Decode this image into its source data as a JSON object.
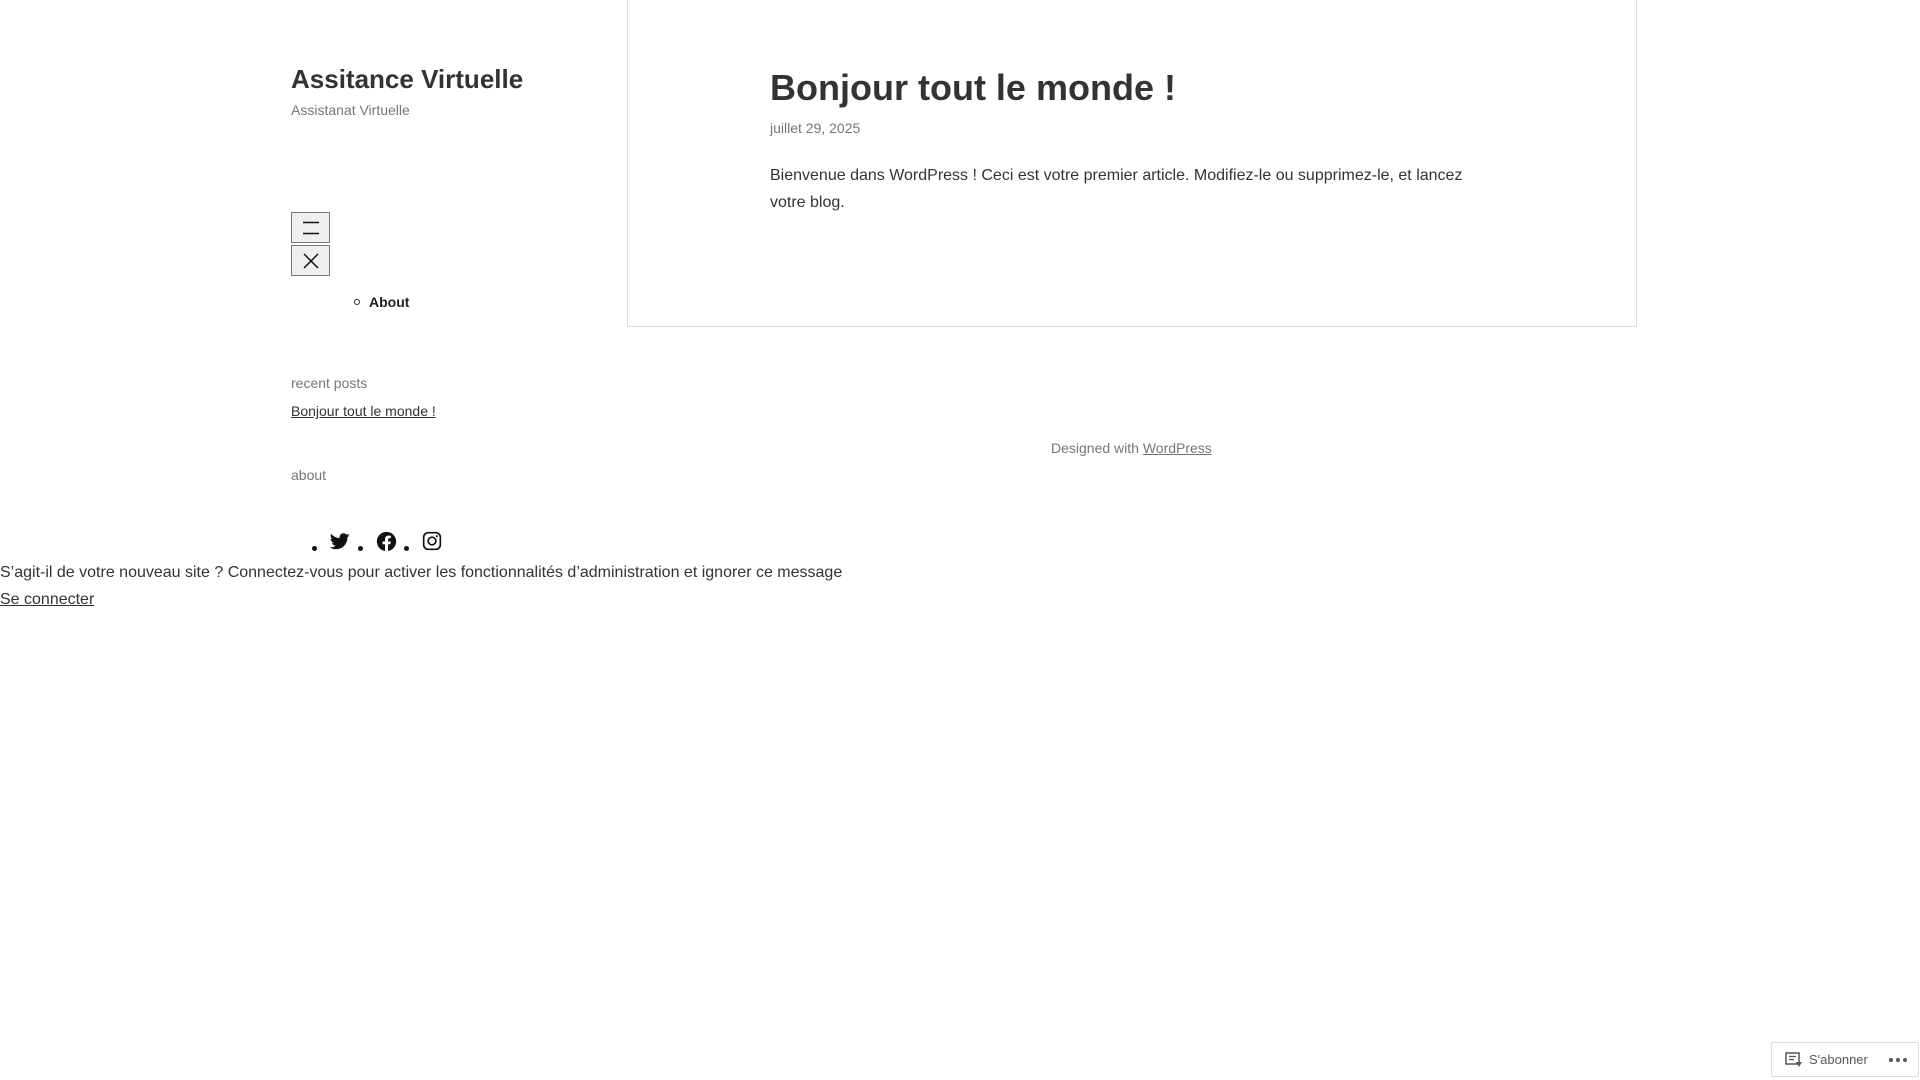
{
  "site": {
    "title": "Assitance Virtuelle",
    "tagline": "Assistanat Virtuelle"
  },
  "navigation": {
    "open_icon": "hamburger-menu-icon",
    "close_icon": "close-icon",
    "items": [
      {
        "label": "About"
      }
    ]
  },
  "widgets": {
    "recent_posts_heading": "recent posts",
    "recent_posts": [
      {
        "label": "Bonjour tout le monde !"
      }
    ],
    "about_heading": "about"
  },
  "social": {
    "icons": [
      "twitter-icon",
      "facebook-icon",
      "instagram-icon"
    ]
  },
  "admin_notice": {
    "message": "S’agit-il de votre nouveau site ? Connectez-vous pour activer les fonctionnalités d’administration et ignorer ce message",
    "login_label": "Se connecter"
  },
  "post": {
    "title": "Bonjour tout le monde !",
    "date": "juillet 29, 2025",
    "body": "Bienvenue dans WordPress ! Ceci est votre premier article. Modifiez-le ou supprimez-le, et lancez votre blog."
  },
  "footer": {
    "credit_prefix": "Designed with",
    "credit_link": "WordPress"
  },
  "subscribe_bar": {
    "subscribe_label": "S'abonner",
    "subscribe_icon": "reader-icon",
    "more_icon": "ellipsis-icon"
  },
  "colors": {
    "text": "#333333",
    "muted": "#767676",
    "border": "#dddddd"
  }
}
